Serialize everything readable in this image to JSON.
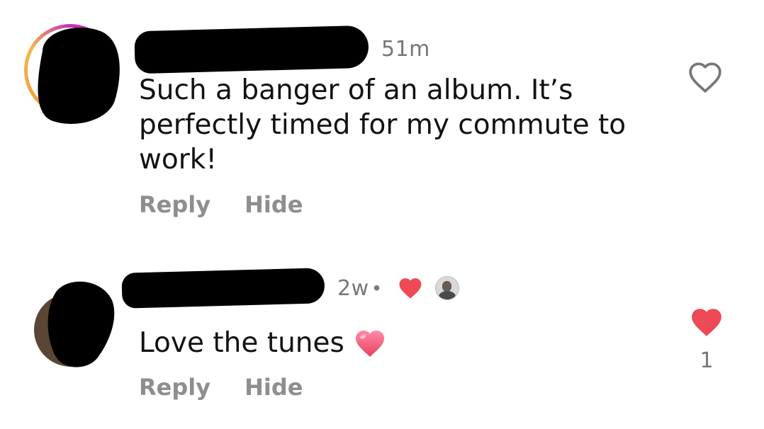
{
  "comments": [
    {
      "time": "51m",
      "text_lines": [
        "Such a banger of an album. It’s",
        "perfectly timed for my commute to",
        "work!"
      ],
      "actions": {
        "reply": "Reply",
        "hide": "Hide"
      },
      "liked": false
    },
    {
      "time": "2w",
      "separator": "•",
      "text": "Love the tunes",
      "actions": {
        "reply": "Reply",
        "hide": "Hide"
      },
      "liked": true,
      "like_count": "1"
    }
  ],
  "colors": {
    "like_red": "#ed4956",
    "muted_text": "#8e8e8e",
    "emoji_heart": "#f06a8a"
  },
  "icons": {
    "outline_heart": "heart-outline-icon",
    "filled_heart": "heart-filled-icon",
    "emoji_heart": "heart-emoji-icon",
    "author_heart": "liked-by-author-heart-icon"
  }
}
